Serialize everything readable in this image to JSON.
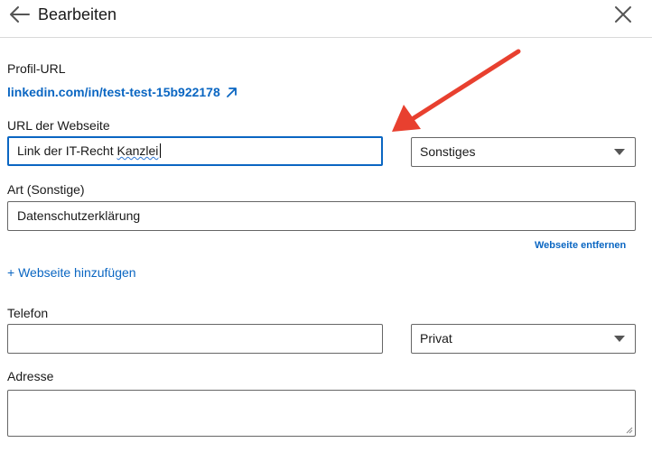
{
  "header": {
    "title": "Bearbeiten",
    "back_icon": "arrow-left-icon",
    "close_icon": "close-icon"
  },
  "profile": {
    "label": "Profil-URL",
    "url": "linkedin.com/in/test-test-15b922178",
    "link_icon": "external-link-icon"
  },
  "website": {
    "label": "URL der Webseite",
    "value_plain": "Link der IT-Recht ",
    "value_misspelled": "Kanzlei",
    "type_selected": "Sonstiges",
    "type_label": "Art (Sonstige)",
    "type_value": "Datenschutzerklärung",
    "remove_label": "Webseite entfernen",
    "add_label": "+ Webseite hinzufügen"
  },
  "phone": {
    "label": "Telefon",
    "value": "",
    "type_selected": "Privat"
  },
  "address": {
    "label": "Adresse",
    "value": ""
  },
  "colors": {
    "link": "#0a66c2",
    "annotation_arrow": "#e8402f",
    "focus_border": "#0a66c2"
  }
}
